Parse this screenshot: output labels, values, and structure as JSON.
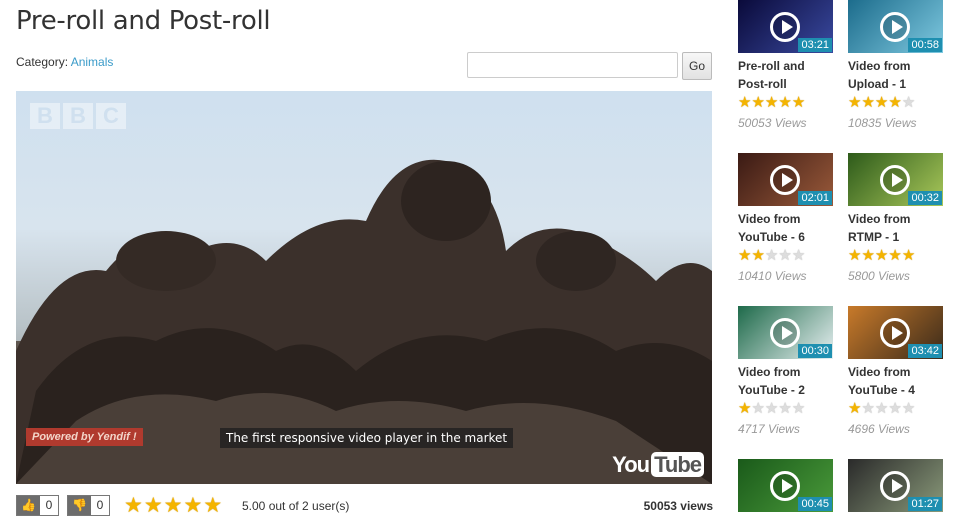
{
  "page": {
    "title": "Pre-roll and Post-roll",
    "category_label": "Category:",
    "category_value": "Animals",
    "search_placeholder": "",
    "search_button": "Go"
  },
  "player": {
    "watermark_letters": [
      "B",
      "B",
      "C"
    ],
    "powered_by": "Powered by Yendif !",
    "caption": "The first responsive video player in the market",
    "logo_you": "You",
    "logo_tube": "Tube"
  },
  "stats": {
    "likes": "0",
    "dislikes": "0",
    "rating": 5,
    "rating_text": "5.00 out of 2 user(s)",
    "views": "50053 views"
  },
  "sidebar": {
    "videos": [
      {
        "title_1": "Pre-roll and",
        "title_2": "Post-roll",
        "duration": "03:21",
        "rating": 5,
        "views": "50053 Views",
        "colors": [
          "#0a0a3a",
          "#3a4aa0"
        ]
      },
      {
        "title_1": "Video from",
        "title_2": "Upload - 1",
        "duration": "00:58",
        "rating": 4,
        "views": "10835 Views",
        "colors": [
          "#1c6c8c",
          "#7fc9e0"
        ]
      },
      {
        "title_1": "Video from",
        "title_2": "YouTube - 6",
        "duration": "02:01",
        "rating": 2.5,
        "views": "10410 Views",
        "colors": [
          "#3a1a14",
          "#9a5a3a"
        ]
      },
      {
        "title_1": "Video from",
        "title_2": "RTMP - 1",
        "duration": "00:32",
        "rating": 5,
        "views": "5800 Views",
        "colors": [
          "#2d5a1a",
          "#a9c85a"
        ]
      },
      {
        "title_1": "Video from",
        "title_2": "YouTube - 2",
        "duration": "00:30",
        "rating": 1.5,
        "views": "4717 Views",
        "colors": [
          "#1e6a4a",
          "#e8f0f2"
        ]
      },
      {
        "title_1": "Video from",
        "title_2": "YouTube - 4",
        "duration": "03:42",
        "rating": 1,
        "views": "4696 Views",
        "colors": [
          "#c87a2a",
          "#3a2a1a"
        ]
      },
      {
        "title_1": "",
        "title_2": "",
        "duration": "00:45",
        "rating": 0,
        "views": "",
        "colors": [
          "#1a5a1a",
          "#4a9a3a"
        ]
      },
      {
        "title_1": "",
        "title_2": "",
        "duration": "01:27",
        "rating": 0,
        "views": "",
        "colors": [
          "#2a2a2a",
          "#8a9a7a"
        ]
      }
    ]
  }
}
